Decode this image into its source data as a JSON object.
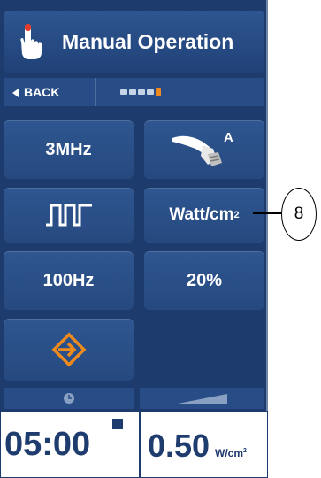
{
  "header": {
    "title": "Manual Operation",
    "icon": "hand-pointer-icon"
  },
  "nav": {
    "back_label": "BACK",
    "steps_total": 5,
    "current_step": 5,
    "accent": "#f08a1c"
  },
  "buttons": {
    "frequency": "3MHz",
    "applicator_label": "A",
    "waveform_icon": "pulse-wave-icon",
    "intensity_unit": "Watt/cm",
    "intensity_unit_sup": "2",
    "pulse_frequency": "100Hz",
    "duty_cycle": "20%",
    "start_icon": "enter-arrow-icon"
  },
  "readouts": {
    "timer_icon": "clock-icon",
    "timer_value": "05:00",
    "power_icon": "ramp-icon",
    "power_value": "0.50",
    "power_unit": "W/cm",
    "power_unit_sup": "2"
  },
  "annotation": {
    "number": "8"
  },
  "colors": {
    "panel": "#1d3b6c",
    "button": "#2f5690",
    "accent": "#f08a1c",
    "text_dark": "#1f3c6e"
  }
}
